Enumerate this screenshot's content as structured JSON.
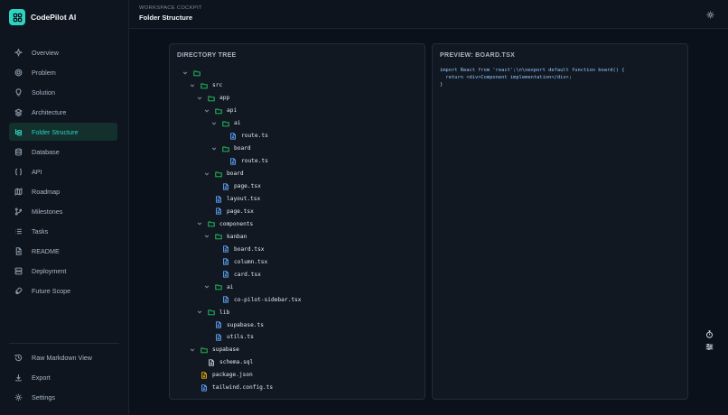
{
  "brand": {
    "name": "CodePilot AI"
  },
  "nav": [
    {
      "label": "Overview",
      "icon": "sparkles-icon"
    },
    {
      "label": "Problem",
      "icon": "target-icon"
    },
    {
      "label": "Solution",
      "icon": "lightbulb-icon"
    },
    {
      "label": "Architecture",
      "icon": "layers-icon"
    },
    {
      "label": "Folder Structure",
      "icon": "folder-tree-icon",
      "active": true
    },
    {
      "label": "Database",
      "icon": "database-icon"
    },
    {
      "label": "API",
      "icon": "braces-icon"
    },
    {
      "label": "Roadmap",
      "icon": "map-icon"
    },
    {
      "label": "Milestones",
      "icon": "git-branch-icon"
    },
    {
      "label": "Tasks",
      "icon": "list-icon"
    },
    {
      "label": "README",
      "icon": "file-text-icon"
    },
    {
      "label": "Deployment",
      "icon": "server-icon"
    },
    {
      "label": "Future Scope",
      "icon": "rocket-icon"
    }
  ],
  "nav_bottom": [
    {
      "label": "Raw Markdown View",
      "icon": "history-icon"
    },
    {
      "label": "Export",
      "icon": "download-icon"
    },
    {
      "label": "Settings",
      "icon": "gear-icon"
    }
  ],
  "header": {
    "kicker": "WORKSPACE COCKPIT",
    "title": "Folder Structure"
  },
  "tree_panel": {
    "title": "DIRECTORY TREE"
  },
  "tree": [
    {
      "name": "",
      "depth": 0,
      "type": "folder",
      "open": true
    },
    {
      "name": "src",
      "depth": 1,
      "type": "folder",
      "open": true
    },
    {
      "name": "app",
      "depth": 2,
      "type": "folder",
      "open": true
    },
    {
      "name": "api",
      "depth": 3,
      "type": "folder",
      "open": true
    },
    {
      "name": "ai",
      "depth": 4,
      "type": "folder",
      "open": true
    },
    {
      "name": "route.ts",
      "depth": 5,
      "type": "file"
    },
    {
      "name": "board",
      "depth": 4,
      "type": "folder",
      "open": true
    },
    {
      "name": "route.ts",
      "depth": 5,
      "type": "file"
    },
    {
      "name": "board",
      "depth": 3,
      "type": "folder",
      "open": true
    },
    {
      "name": "page.tsx",
      "depth": 4,
      "type": "file"
    },
    {
      "name": "layout.tsx",
      "depth": 3,
      "type": "file"
    },
    {
      "name": "page.tsx",
      "depth": 3,
      "type": "file"
    },
    {
      "name": "components",
      "depth": 2,
      "type": "folder",
      "open": true
    },
    {
      "name": "kanban",
      "depth": 3,
      "type": "folder",
      "open": true
    },
    {
      "name": "board.tsx",
      "depth": 4,
      "type": "file"
    },
    {
      "name": "column.tsx",
      "depth": 4,
      "type": "file"
    },
    {
      "name": "card.tsx",
      "depth": 4,
      "type": "file"
    },
    {
      "name": "ai",
      "depth": 3,
      "type": "folder",
      "open": true
    },
    {
      "name": "co-pilot-sidebar.tsx",
      "depth": 4,
      "type": "file"
    },
    {
      "name": "lib",
      "depth": 2,
      "type": "folder",
      "open": true
    },
    {
      "name": "supabase.ts",
      "depth": 3,
      "type": "file"
    },
    {
      "name": "utils.ts",
      "depth": 3,
      "type": "file"
    },
    {
      "name": "supabase",
      "depth": 1,
      "type": "folder",
      "open": true
    },
    {
      "name": "schema.sql",
      "depth": 2,
      "type": "file",
      "plain": true
    },
    {
      "name": "package.json",
      "depth": 1,
      "type": "file",
      "json": true
    },
    {
      "name": "tailwind.config.ts",
      "depth": 1,
      "type": "file"
    }
  ],
  "preview_panel": {
    "title": "PREVIEW: BOARD.TSX",
    "code": "import React from 'react';\\n\\nexport default function board() {\n  return <div>Component implementation</div>;\n}"
  },
  "colors": {
    "accent": "#2dd4bf",
    "folder": "#22c55e",
    "file": "#60a5fa",
    "json": "#eab308"
  }
}
